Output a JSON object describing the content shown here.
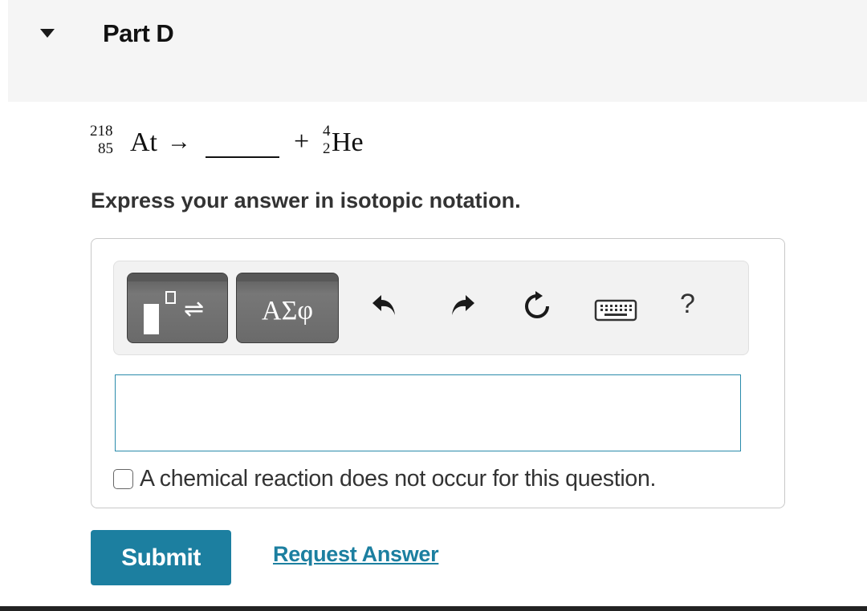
{
  "part": {
    "title": "Part D"
  },
  "equation": {
    "reactant": {
      "mass": "218",
      "atomic": "85",
      "symbol": "At"
    },
    "arrow": "→",
    "plus": "+",
    "product": {
      "mass": "4",
      "atomic": "2",
      "symbol": "He"
    }
  },
  "instruction": "Express your answer in isotopic notation.",
  "toolbar": {
    "templates_arrow": "⇌",
    "greek_label": "ΑΣφ",
    "help_label": "?",
    "icons": [
      "templates-icon",
      "greek-letters-icon",
      "undo-icon",
      "redo-icon",
      "reset-icon",
      "keyboard-icon",
      "help-icon"
    ]
  },
  "answer": {
    "value": ""
  },
  "no_reaction": {
    "checked": false,
    "label": "A chemical reaction does not occur for this question."
  },
  "actions": {
    "submit_label": "Submit",
    "request_label": "Request Answer"
  },
  "colors": {
    "accent": "#1c7fa0",
    "input_border": "#2a8bab",
    "header_bg": "#f5f5f5",
    "toolbar_button": "#6a6a6a"
  }
}
